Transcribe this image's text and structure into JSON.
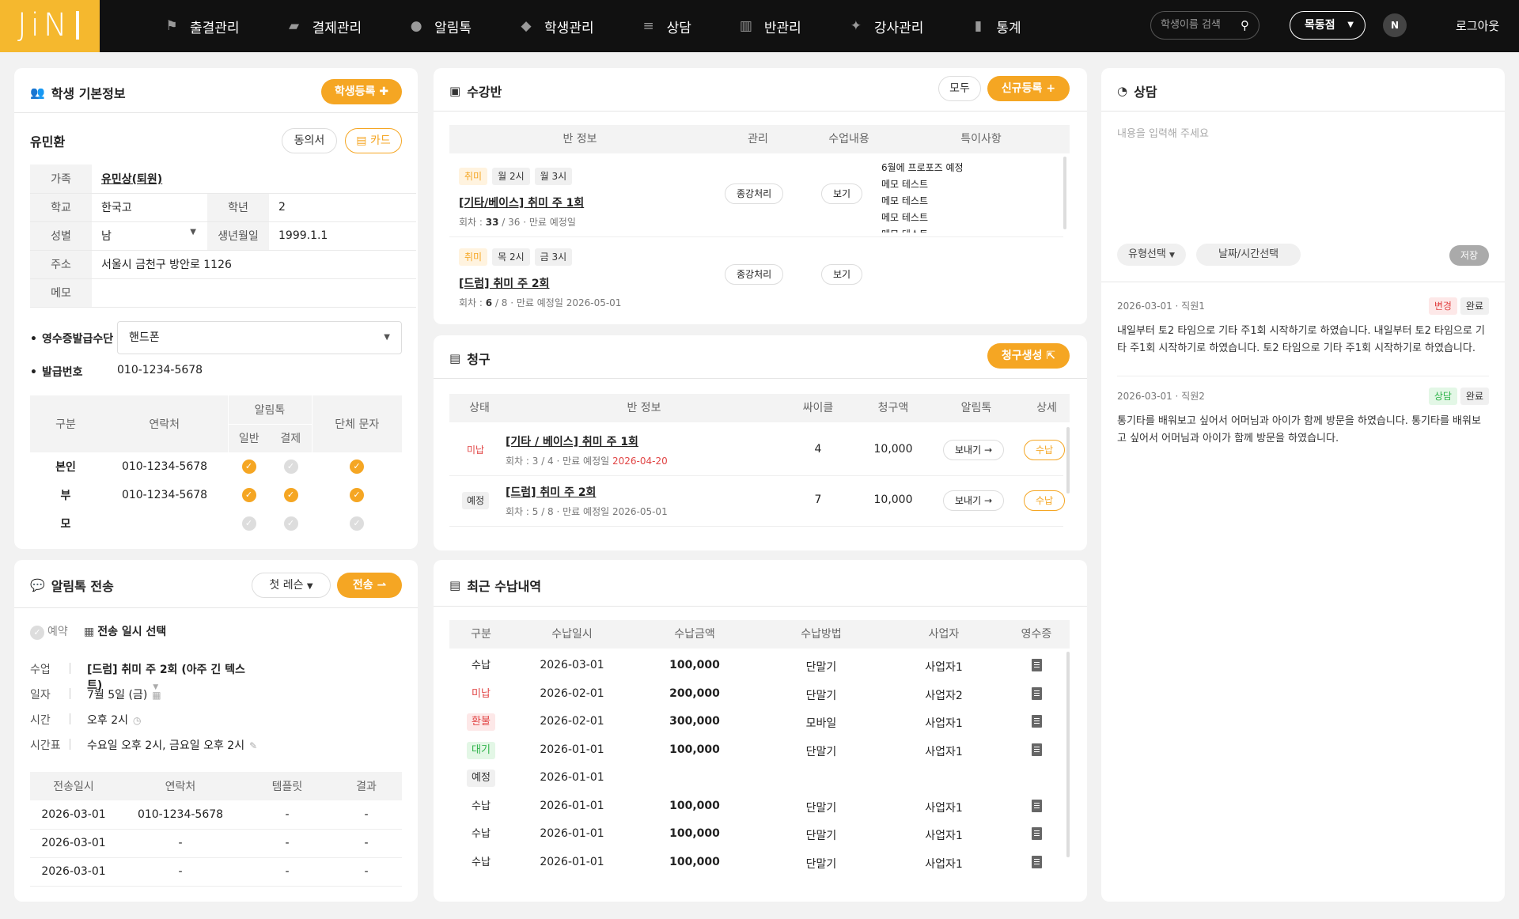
{
  "nav": {
    "logo": "JiN",
    "items": [
      "출결관리",
      "결제관리",
      "알림톡",
      "학생관리",
      "상담",
      "반관리",
      "강사관리",
      "통계"
    ],
    "icons": [
      "stamp-icon",
      "wallet-icon",
      "talk-icon",
      "graduation-cap-icon",
      "chat-icon",
      "board-icon",
      "teacher-icon",
      "chart-icon"
    ],
    "search_placeholder": "학생이름 검색",
    "branch": "목동점",
    "notion": "N",
    "logout": "로그아웃"
  },
  "student": {
    "title": "학생 기본정보",
    "register_btn": "학생등록",
    "name": "유민환",
    "consent_btn": "동의서",
    "card_btn": "카드",
    "rows": {
      "family_label": "가족",
      "family": "유민상(퇴원)",
      "school_label": "학교",
      "school": "한국고",
      "grade_label": "학년",
      "grade": "2",
      "gender_label": "성별",
      "gender": "남",
      "birth_label": "생년월일",
      "birth": "1999.1.1",
      "address_label": "주소",
      "address": "서울시 금천구 방안로 1126",
      "memo_label": "메모"
    },
    "receipt_label": "영수증발급수단",
    "receipt_value": "핸드폰",
    "issue_label": "발급번호",
    "issue_value": "010-1234-5678",
    "contact_headers": {
      "type": "구분",
      "contact": "연락처",
      "alim": "알림톡",
      "normal": "일반",
      "pay": "결제",
      "group": "단체 문자"
    },
    "contacts": [
      {
        "type": "본인",
        "phone": "010-1234-5678",
        "normal": true,
        "pay": false,
        "group": true
      },
      {
        "type": "부",
        "phone": "010-1234-5678",
        "normal": true,
        "pay": true,
        "group": true
      },
      {
        "type": "모",
        "phone": "",
        "normal": false,
        "pay": false,
        "group": false
      }
    ]
  },
  "alimtalk": {
    "title": "알림톡 전송",
    "template_select": "첫 레슨",
    "send_btn": "전송",
    "reserve": "예약",
    "datetime": "전송 일시 선택",
    "fields": [
      {
        "label": "수업",
        "value": "[드럼] 취미 주 2회 (아주 긴 텍스트)"
      },
      {
        "label": "일자",
        "value": "7월 5일 (금)"
      },
      {
        "label": "시간",
        "value": "오후 2시"
      },
      {
        "label": "시간표",
        "value": "수요일 오후 2시, 금요일 오후 2시"
      }
    ],
    "headers": [
      "전송일시",
      "연락처",
      "템플릿",
      "결과"
    ],
    "rows": [
      [
        "2026-03-01",
        "010-1234-5678",
        "-",
        "-"
      ],
      [
        "2026-03-01",
        "-",
        "-",
        "-"
      ],
      [
        "2026-03-01",
        "-",
        "-",
        "-"
      ]
    ]
  },
  "classes": {
    "title": "수강반",
    "all_btn": "모두",
    "new_btn": "신규등록",
    "headers": [
      "반 정보",
      "관리",
      "수업내용",
      "특이사항"
    ],
    "items": [
      {
        "tag": "취미",
        "days": [
          "월 2시",
          "월 3시"
        ],
        "name": "[기타/베이스] 취미 주 1회",
        "meta_prefix": "회차 : ",
        "count": "33",
        "meta_suffix": " / 36 · 만료 예정일",
        "manage": "종강처리",
        "view": "보기",
        "notes": [
          "6월에 프로포즈 예정",
          "메모 테스트",
          "메모 테스트",
          "메모 테스트",
          "메모 테스트"
        ]
      },
      {
        "tag": "취미",
        "days": [
          "목 2시",
          "금 3시"
        ],
        "name": "[드럼] 취미 주 2회",
        "meta_prefix": "회차 : ",
        "count": "6",
        "meta_suffix": " / 8 · 만료 예정일 2026-05-01",
        "manage": "종강처리",
        "view": "보기",
        "notes": []
      }
    ]
  },
  "billing": {
    "title": "청구",
    "create_btn": "청구생성",
    "headers": [
      "상태",
      "반 정보",
      "싸이클",
      "청구액",
      "알림톡",
      "상세"
    ],
    "rows": [
      {
        "status": "미납",
        "name": "[기타 / 베이스] 취미 주 1회",
        "meta": "회차 : 3 / 4 · 만료 예정일 ",
        "date": "2026-04-20",
        "cycle": "4",
        "amount": "10,000",
        "send": "보내기",
        "detail": "수납"
      },
      {
        "status": "예정",
        "name": "[드럼] 취미 주 2회",
        "meta": "회차 : 5 / 8 · 만료 예정일 2026-05-01",
        "date": "",
        "cycle": "7",
        "amount": "10,000",
        "send": "보내기",
        "detail": "수납"
      }
    ]
  },
  "payments": {
    "title": "최근 수납내역",
    "headers": [
      "구분",
      "수납일시",
      "수납금액",
      "수납방법",
      "사업자",
      "영수증"
    ],
    "rows": [
      {
        "type": "수납",
        "date": "2026-03-01",
        "amount": "100,000",
        "method": "단말기",
        "biz": "사업자1",
        "receipt": true
      },
      {
        "type": "미납",
        "date": "2026-02-01",
        "amount": "200,000",
        "method": "단말기",
        "biz": "사업자2",
        "receipt": true
      },
      {
        "type": "환불",
        "date": "2026-02-01",
        "amount": "300,000",
        "method": "모바일",
        "biz": "사업자1",
        "receipt": true
      },
      {
        "type": "대기",
        "date": "2026-01-01",
        "amount": "100,000",
        "method": "단말기",
        "biz": "사업자1",
        "receipt": true
      },
      {
        "type": "예정",
        "date": "2026-01-01",
        "amount": "",
        "method": "",
        "biz": "",
        "receipt": false
      },
      {
        "type": "수납",
        "date": "2026-01-01",
        "amount": "100,000",
        "method": "단말기",
        "biz": "사업자1",
        "receipt": true
      },
      {
        "type": "수납",
        "date": "2026-01-01",
        "amount": "100,000",
        "method": "단말기",
        "biz": "사업자1",
        "receipt": true
      },
      {
        "type": "수납",
        "date": "2026-01-01",
        "amount": "100,000",
        "method": "단말기",
        "biz": "사업자1",
        "receipt": true
      }
    ]
  },
  "consult": {
    "title": "상담",
    "placeholder": "내용을 입력해 주세요",
    "type_select": "유형선택",
    "date_select": "날짜/시간선택",
    "save_btn": "저장",
    "entries": [
      {
        "meta": "2026-03-01 · 직원1",
        "tag": "변경",
        "status": "완료",
        "text": "내일부터 토2 타임으로 기타 주1회 시작하기로 하였습니다. 내일부터 토2 타임으로 기타 주1회 시작하기로 하였습니다. 토2 타임으로 기타 주1회 시작하기로 하였습니다."
      },
      {
        "meta": "2026-03-01 · 직원2",
        "tag": "상담",
        "status": "완료",
        "text": "통기타를 배워보고 싶어서 어머님과 아이가 함께 방문을 하였습니다. 통기타를 배워보고 싶어서 어머님과 아이가 함께 방문을 하였습니다."
      }
    ]
  },
  "colors": {
    "accent": "#f5a623",
    "topbar": "#111111"
  }
}
